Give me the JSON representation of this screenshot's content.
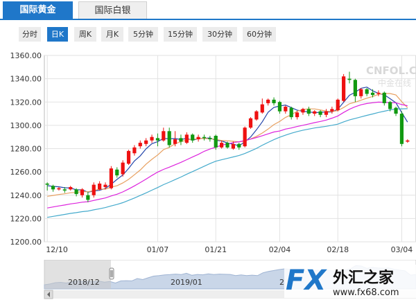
{
  "tabs": {
    "active": "国际黄金",
    "inactive": "国际白银"
  },
  "periods": [
    {
      "label": "分时",
      "active": false
    },
    {
      "label": "日K",
      "active": true
    },
    {
      "label": "周K",
      "active": false
    },
    {
      "label": "月K",
      "active": false
    },
    {
      "label": "5分钟",
      "active": false
    },
    {
      "label": "15分钟",
      "active": false
    },
    {
      "label": "30分钟",
      "active": false
    },
    {
      "label": "60分钟",
      "active": false
    }
  ],
  "watermark": {
    "text": "CNFOL.COM",
    "sub": "中金在线"
  },
  "brand": {
    "main": "FX",
    "cn": "外汇之家",
    "url": "www.fx68.com"
  },
  "navigator": {
    "labels": [
      "2018/12",
      "2019/01",
      "2"
    ]
  },
  "colors": {
    "up": "#ee1111",
    "down": "#119911",
    "ma_blue": "#2244aa",
    "ma_orange": "#e8a060",
    "ma_magenta": "#dd22dd",
    "ma_teal": "#44aacc",
    "accent": "#1f77c9"
  },
  "chart_data": {
    "type": "candlestick",
    "ylim": [
      1200,
      1360
    ],
    "yticks": [
      "1360.00",
      "1340.00",
      "1320.00",
      "1300.00",
      "1280.00",
      "1260.00",
      "1240.00",
      "1220.00",
      "1200.00"
    ],
    "xticks": [
      "12/10",
      "01/07",
      "01/21",
      "02/04",
      "02/18",
      "03/04"
    ],
    "xtick_index": [
      0,
      19,
      29,
      40,
      50,
      61
    ],
    "candles": [
      [
        1250,
        1249,
        1244,
        1251
      ],
      [
        1248,
        1245,
        1243,
        1249
      ],
      [
        1245,
        1246,
        1244,
        1247
      ],
      [
        1245,
        1244,
        1242,
        1247
      ],
      [
        1245,
        1247,
        1244,
        1248
      ],
      [
        1245,
        1241,
        1239,
        1246
      ],
      [
        1240,
        1245,
        1238,
        1246
      ],
      [
        1240,
        1236,
        1234,
        1243
      ],
      [
        1240,
        1249,
        1238,
        1251
      ],
      [
        1245,
        1250,
        1244,
        1252
      ],
      [
        1247,
        1249,
        1245,
        1251
      ],
      [
        1246,
        1263,
        1245,
        1265
      ],
      [
        1262,
        1257,
        1255,
        1264
      ],
      [
        1258,
        1268,
        1256,
        1270
      ],
      [
        1267,
        1278,
        1266,
        1279
      ],
      [
        1276,
        1281,
        1274,
        1283
      ],
      [
        1282,
        1285,
        1280,
        1287
      ],
      [
        1284,
        1287,
        1282,
        1289
      ],
      [
        1287,
        1290,
        1285,
        1292
      ],
      [
        1289,
        1287,
        1282,
        1293
      ],
      [
        1287,
        1295,
        1286,
        1298
      ],
      [
        1295,
        1283,
        1281,
        1298
      ],
      [
        1284,
        1288,
        1282,
        1295
      ],
      [
        1289,
        1286,
        1283,
        1292
      ],
      [
        1285,
        1292,
        1284,
        1294
      ],
      [
        1292,
        1287,
        1285,
        1293
      ],
      [
        1288,
        1290,
        1286,
        1292
      ],
      [
        1290,
        1289,
        1287,
        1292
      ],
      [
        1289,
        1288,
        1286,
        1291
      ],
      [
        1291,
        1281,
        1279,
        1292
      ],
      [
        1281,
        1285,
        1280,
        1287
      ],
      [
        1285,
        1281,
        1280,
        1286
      ],
      [
        1280,
        1284,
        1279,
        1286
      ],
      [
        1284,
        1281,
        1279,
        1285
      ],
      [
        1282,
        1298,
        1281,
        1299
      ],
      [
        1298,
        1306,
        1297,
        1307
      ],
      [
        1305,
        1312,
        1304,
        1313
      ],
      [
        1311,
        1318,
        1310,
        1323
      ],
      [
        1319,
        1322,
        1317,
        1323
      ],
      [
        1322,
        1319,
        1317,
        1324
      ],
      [
        1320,
        1312,
        1310,
        1321
      ],
      [
        1312,
        1316,
        1310,
        1317
      ],
      [
        1315,
        1307,
        1305,
        1316
      ],
      [
        1307,
        1311,
        1305,
        1312
      ],
      [
        1311,
        1314,
        1309,
        1315
      ],
      [
        1314,
        1310,
        1308,
        1316
      ],
      [
        1310,
        1312,
        1308,
        1313
      ],
      [
        1312,
        1309,
        1307,
        1313
      ],
      [
        1309,
        1312,
        1307,
        1314
      ],
      [
        1312,
        1314,
        1310,
        1316
      ],
      [
        1313,
        1322,
        1312,
        1323
      ],
      [
        1321,
        1342,
        1320,
        1344
      ],
      [
        1340,
        1339,
        1336,
        1346
      ],
      [
        1339,
        1325,
        1320,
        1340
      ],
      [
        1325,
        1331,
        1323,
        1332
      ],
      [
        1331,
        1327,
        1325,
        1332
      ],
      [
        1328,
        1326,
        1324,
        1331
      ],
      [
        1327,
        1328,
        1325,
        1330
      ],
      [
        1328,
        1319,
        1317,
        1329
      ],
      [
        1320,
        1314,
        1312,
        1321
      ],
      [
        1315,
        1310,
        1308,
        1316
      ],
      [
        1310,
        1284,
        1282,
        1312
      ],
      [
        1286,
        1287,
        1285,
        1288
      ]
    ]
  }
}
